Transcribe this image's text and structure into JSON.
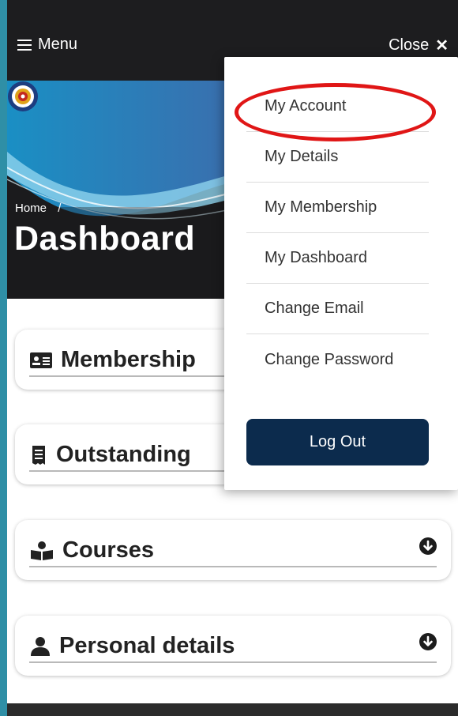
{
  "topbar": {
    "menu_label": "Menu",
    "close_label": "Close"
  },
  "hero": {
    "breadcrumb_home": "Home",
    "breadcrumb_sep": "/",
    "title": "Dashboard"
  },
  "cards": [
    {
      "title": "Membership",
      "icon": "id-card-icon"
    },
    {
      "title": "Outstanding",
      "icon": "receipt-icon"
    },
    {
      "title": "Courses",
      "icon": "reading-icon"
    },
    {
      "title": "Personal details",
      "icon": "user-icon"
    }
  ],
  "dropdown": {
    "items": [
      "My Account",
      "My Details",
      "My Membership",
      "My Dashboard",
      "Change Email",
      "Change Password"
    ],
    "logout_label": "Log Out",
    "highlight_color": "#e01616"
  },
  "colors": {
    "topbar": "#1d1d1f",
    "logout_bg": "#0c2b4d",
    "frame": "#2f8fa6"
  }
}
